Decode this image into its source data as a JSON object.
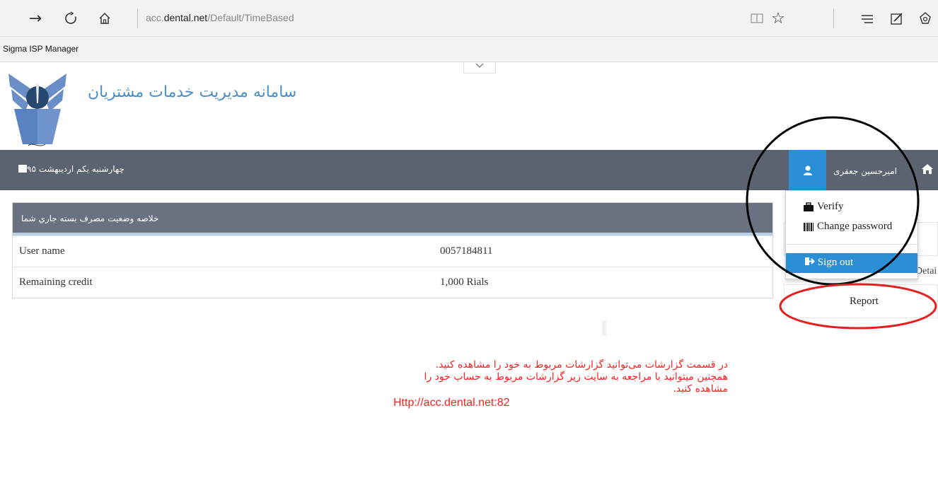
{
  "browser": {
    "url_prefix": "acc.",
    "url_host": "dental.net",
    "url_path": "/Default/TimeBased",
    "favorites_item": "Sigma ISP Manager"
  },
  "header": {
    "site_title": "سامانه مدیریت خدمات مشتریان"
  },
  "topbar": {
    "date": "چهارشنبه یکم اردیبهشت ۹۵",
    "user_name": "امیرحسین جعفری"
  },
  "panel": {
    "title": "خلاصه وضعیت مصرف بسته جاري شما",
    "rows": [
      {
        "label": "User name",
        "value": "0057184811"
      },
      {
        "label": "Remaining credit",
        "value": "1,000 Rials"
      }
    ]
  },
  "user_menu": {
    "verify": "Verify",
    "change_password": "Change password",
    "sign_out": "Sign out"
  },
  "side": {
    "detail_fragment": "Detai",
    "report": "Report"
  },
  "annotation": {
    "line1": "در قسمت گزارشات می‌توانید گزارشات مربوط به خود را مشاهده کنید.",
    "line2": "همچنین میتوانید با مراجعه به سایت زیر گزارشات مربوط به حساب خود را مشاهده کنید.",
    "url": "Http://acc.dental.net:82"
  },
  "colors": {
    "accent_blue": "#2b8fd6",
    "topbar": "#5b6270",
    "annotation_red": "#ff1e1e",
    "circle_black": "#000000"
  }
}
